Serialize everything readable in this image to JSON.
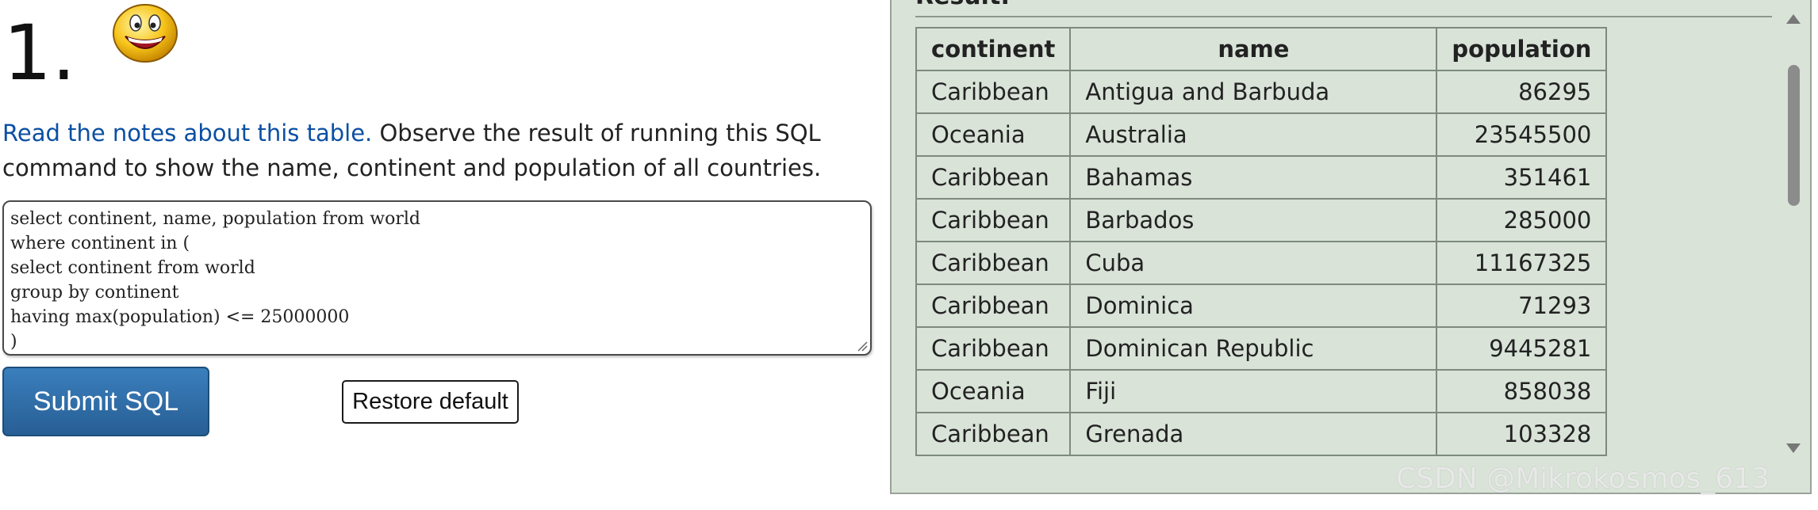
{
  "question": {
    "number": "1.",
    "emoji_icon": "grinning-smiley-icon"
  },
  "intro": {
    "link_text": "Read the notes about this table.",
    "text": " Observe the result of running this SQL command to show the name, continent and population of all countries."
  },
  "sql_editor": {
    "lines": [
      "select continent, name, population from world",
      "where continent in (",
      "select continent from world",
      "group by continent",
      "having max(population) <= 25000000",
      ")"
    ]
  },
  "buttons": {
    "submit_label": "Submit SQL",
    "restore_label": "Restore default"
  },
  "result": {
    "legend": "Result:",
    "columns": [
      "continent",
      "name",
      "population"
    ],
    "rows": [
      [
        "Caribbean",
        "Antigua and Barbuda",
        "86295"
      ],
      [
        "Oceania",
        "Australia",
        "23545500"
      ],
      [
        "Caribbean",
        "Bahamas",
        "351461"
      ],
      [
        "Caribbean",
        "Barbados",
        "285000"
      ],
      [
        "Caribbean",
        "Cuba",
        "11167325"
      ],
      [
        "Caribbean",
        "Dominica",
        "71293"
      ],
      [
        "Caribbean",
        "Dominican Republic",
        "9445281"
      ],
      [
        "Oceania",
        "Fiji",
        "858038"
      ],
      [
        "Caribbean",
        "Grenada",
        "103328"
      ]
    ]
  },
  "watermark": "CSDN @Mikrokosmos_613",
  "colors": {
    "link": "#0b4fa3",
    "submit_button": "#2f6ca6",
    "result_background": "#d9e3d8"
  }
}
